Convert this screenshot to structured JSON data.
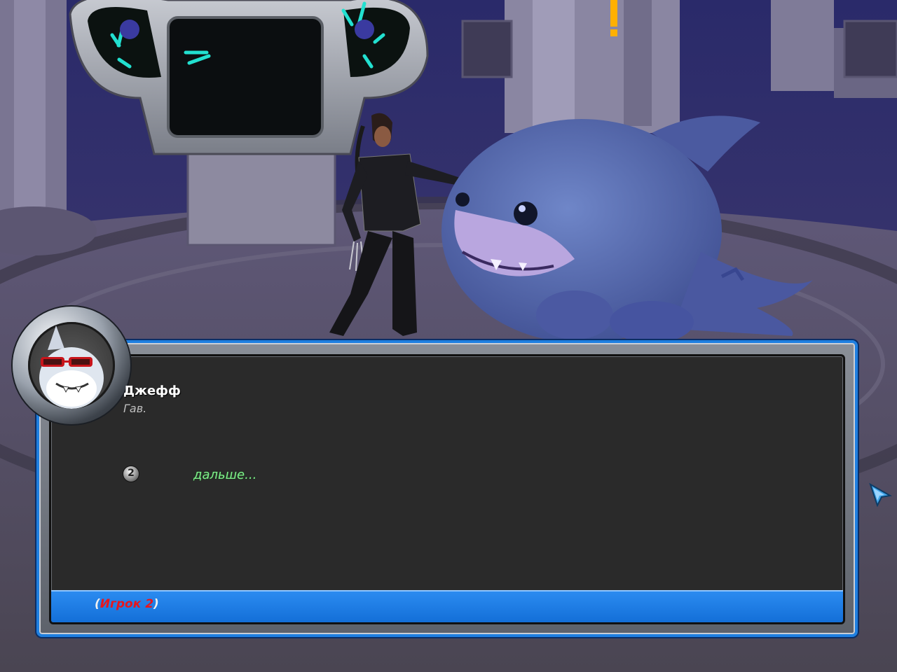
{
  "dialog": {
    "speaker_name": "Джефф",
    "line": "Гав.",
    "choices": [
      {
        "key": "2",
        "text": "дальше..."
      }
    ],
    "player_bar": {
      "open_paren": "(",
      "player_name": "Игрок 2",
      "close_paren": ")"
    }
  },
  "colors": {
    "frame_accent": "#1f7fe0",
    "choice_text": "#7ff08a",
    "player_name": "#e8161c",
    "quest_marker": "#ffb000"
  },
  "icons": {
    "portrait": "shark-portrait-icon",
    "choice_key": "button-2-icon",
    "cursor": "cursor-arrow-icon",
    "quest_marker": "exclamation-marker-icon"
  }
}
